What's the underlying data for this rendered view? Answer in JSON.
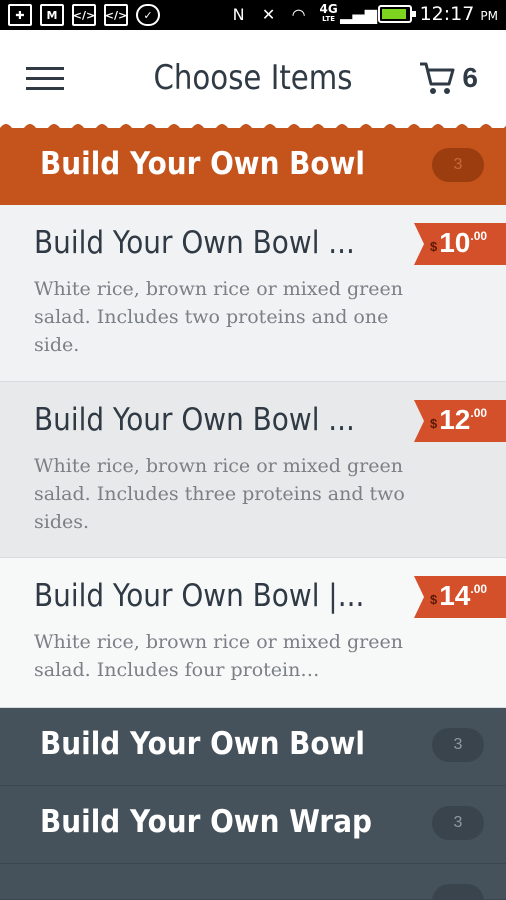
{
  "status_bar": {
    "time": "12:17",
    "ampm": "PM",
    "network": "4G",
    "network_sub": "LTE"
  },
  "header": {
    "title": "Choose Items",
    "cart_count": "6"
  },
  "active_category": {
    "title": "Build Your Own Bowl",
    "count": "3"
  },
  "items": [
    {
      "name": "Build Your Own Bowl ...",
      "description": "White rice, brown rice or mixed green salad. Includes two proteins and one side.",
      "currency": "$",
      "price_dollars": "10",
      "price_cents": ".00"
    },
    {
      "name": "Build Your Own Bowl ...",
      "description": "White rice, brown rice or mixed green salad. Includes three proteins and two sides.",
      "currency": "$",
      "price_dollars": "12",
      "price_cents": ".00"
    },
    {
      "name": "Build Your Own Bowl |...",
      "description": "White rice, brown rice or mixed green salad. Includes four protein…",
      "currency": "$",
      "price_dollars": "14",
      "price_cents": ".00"
    }
  ],
  "categories": [
    {
      "title": "Build Your Own Bowl",
      "count": "3"
    },
    {
      "title": "Build Your Own Wrap",
      "count": "3"
    }
  ],
  "colors": {
    "accent": "#c4531c",
    "price_tag": "#d4502a",
    "dark_category": "#46525b"
  }
}
